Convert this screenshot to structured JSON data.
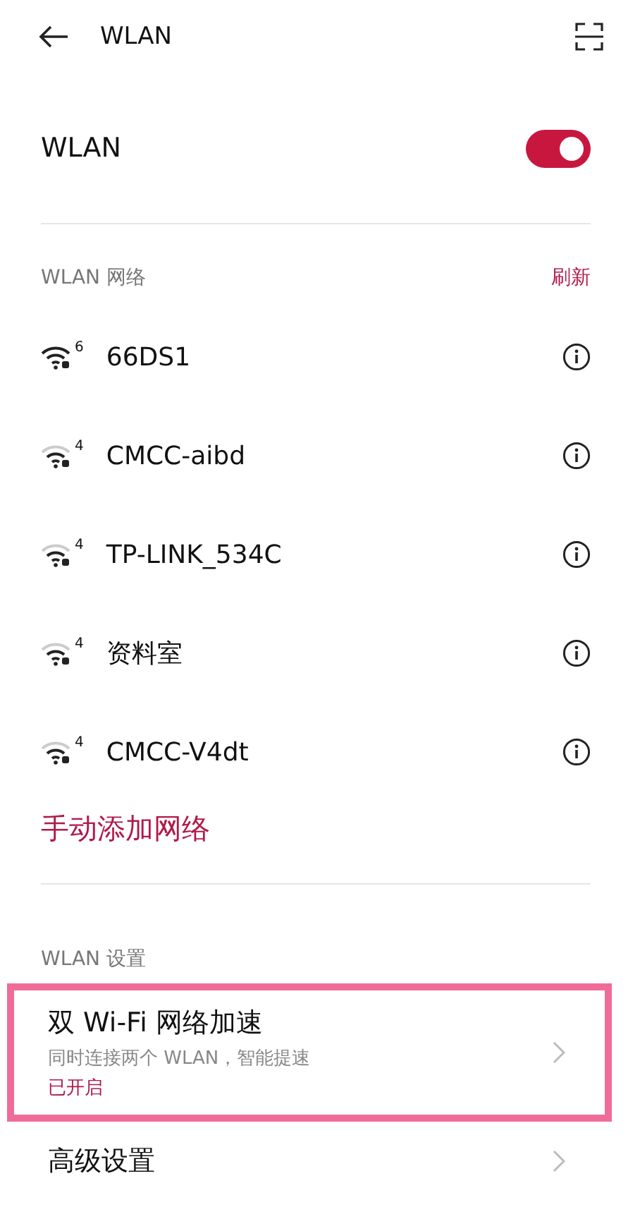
{
  "header": {
    "title": "WLAN"
  },
  "wlan": {
    "label": "WLAN",
    "on": true
  },
  "networks_section": {
    "title": "WLAN 网络",
    "action": "刷新"
  },
  "networks": [
    {
      "name": "66DS1",
      "standard": "6",
      "strong": true
    },
    {
      "name": "CMCC-aibd",
      "standard": "4",
      "strong": false
    },
    {
      "name": "TP-LINK_534C",
      "standard": "4",
      "strong": false
    },
    {
      "name": "资料室",
      "standard": "4",
      "strong": false
    },
    {
      "name": "CMCC-V4dt",
      "standard": "4",
      "strong": false
    }
  ],
  "add_network": "手动添加网络",
  "settings_section": {
    "title": "WLAN 设置"
  },
  "settings": [
    {
      "title": "双 Wi-Fi 网络加速",
      "subtitle": "同时连接两个 WLAN，智能提速",
      "status": "已开启",
      "highlighted": true
    },
    {
      "title": "高级设置",
      "highlighted": false
    }
  ]
}
